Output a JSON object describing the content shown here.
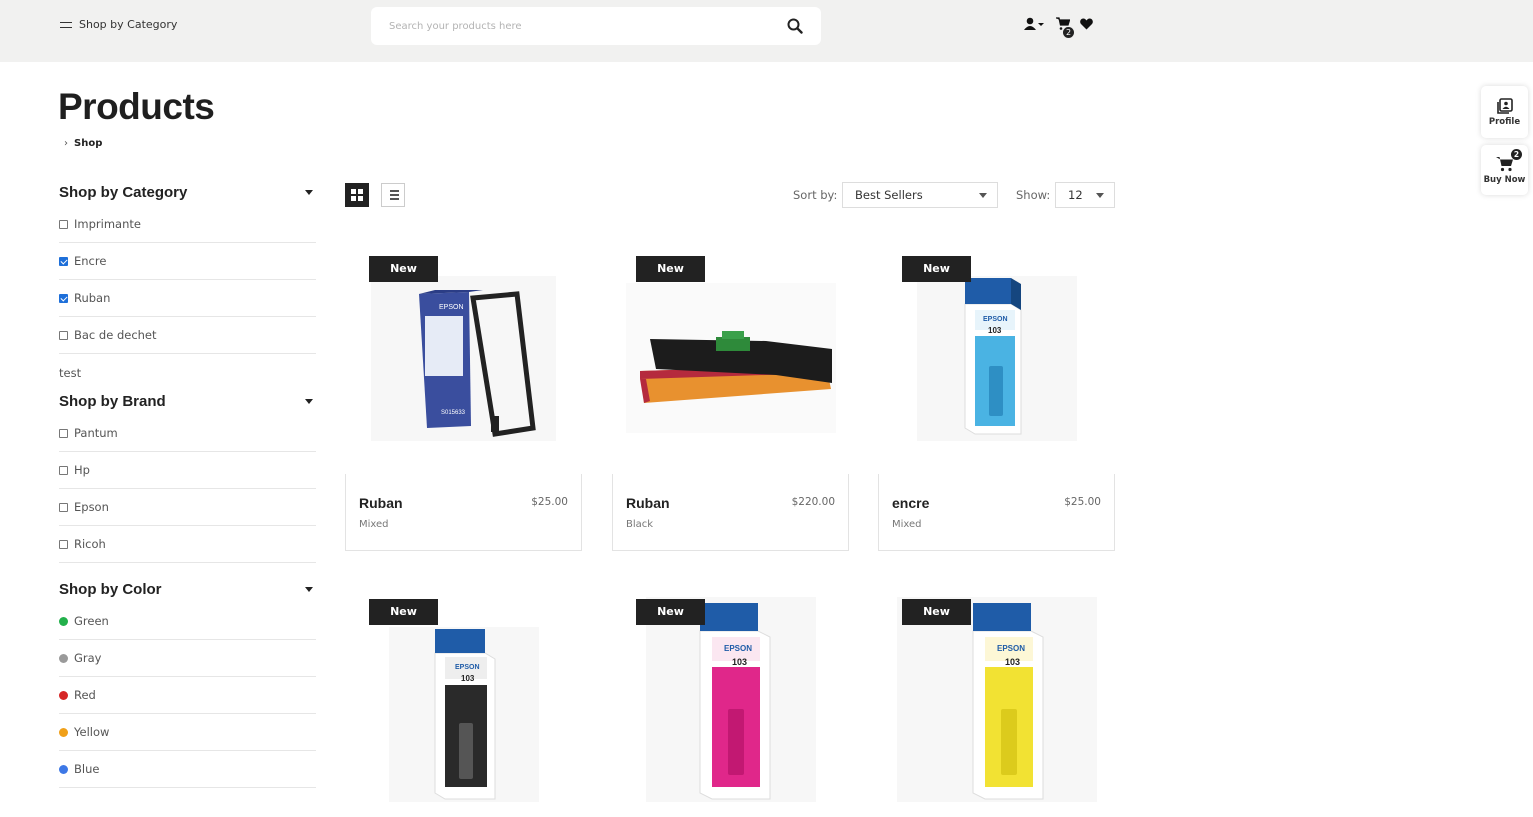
{
  "header": {
    "shop_by_category": "Shop by Category",
    "search_placeholder": "Search your products here",
    "cart_count": "2"
  },
  "page": {
    "title": "Products",
    "breadcrumb": "Shop"
  },
  "filters": {
    "category": {
      "title": "Shop by Category",
      "items": [
        {
          "label": "Imprimante",
          "checked": false
        },
        {
          "label": "Encre",
          "checked": true
        },
        {
          "label": "Ruban",
          "checked": true
        },
        {
          "label": "Bac de dechet",
          "checked": false
        },
        {
          "label": "test"
        }
      ]
    },
    "brand": {
      "title": "Shop by Brand",
      "items": [
        {
          "label": "Pantum",
          "checked": false
        },
        {
          "label": "Hp",
          "checked": false
        },
        {
          "label": "Epson",
          "checked": false
        },
        {
          "label": "Ricoh",
          "checked": false
        }
      ]
    },
    "color": {
      "title": "Shop by Color",
      "items": [
        {
          "label": "Green",
          "color": "#22b04b"
        },
        {
          "label": "Gray",
          "color": "#9a9a9a"
        },
        {
          "label": "Red",
          "color": "#d62626"
        },
        {
          "label": "Yellow",
          "color": "#f0a019"
        },
        {
          "label": "Blue",
          "color": "#3d78e6"
        }
      ]
    }
  },
  "toolbar": {
    "sort_label": "Sort by:",
    "sort_value": "Best Sellers",
    "show_label": "Show:",
    "show_value": "12"
  },
  "products": [
    {
      "badge": "New",
      "name": "Ruban",
      "price": "$25.00",
      "color": "Mixed",
      "image": "epson-ribbon-box-icon"
    },
    {
      "badge": "New",
      "name": "Ruban",
      "price": "$220.00",
      "color": "Black",
      "image": "printer-ribbon-icon"
    },
    {
      "badge": "New",
      "name": "encre",
      "price": "$25.00",
      "color": "Mixed",
      "image": "epson-103-cyan-ink-icon"
    },
    {
      "badge": "New",
      "image": "epson-103-black-ink-icon"
    },
    {
      "badge": "New",
      "image": "epson-103-magenta-ink-icon"
    },
    {
      "badge": "New",
      "image": "epson-103-yellow-ink-icon"
    }
  ],
  "float": {
    "profile_label": "Profile",
    "buy_label": "Buy Now",
    "buy_count": "2"
  }
}
